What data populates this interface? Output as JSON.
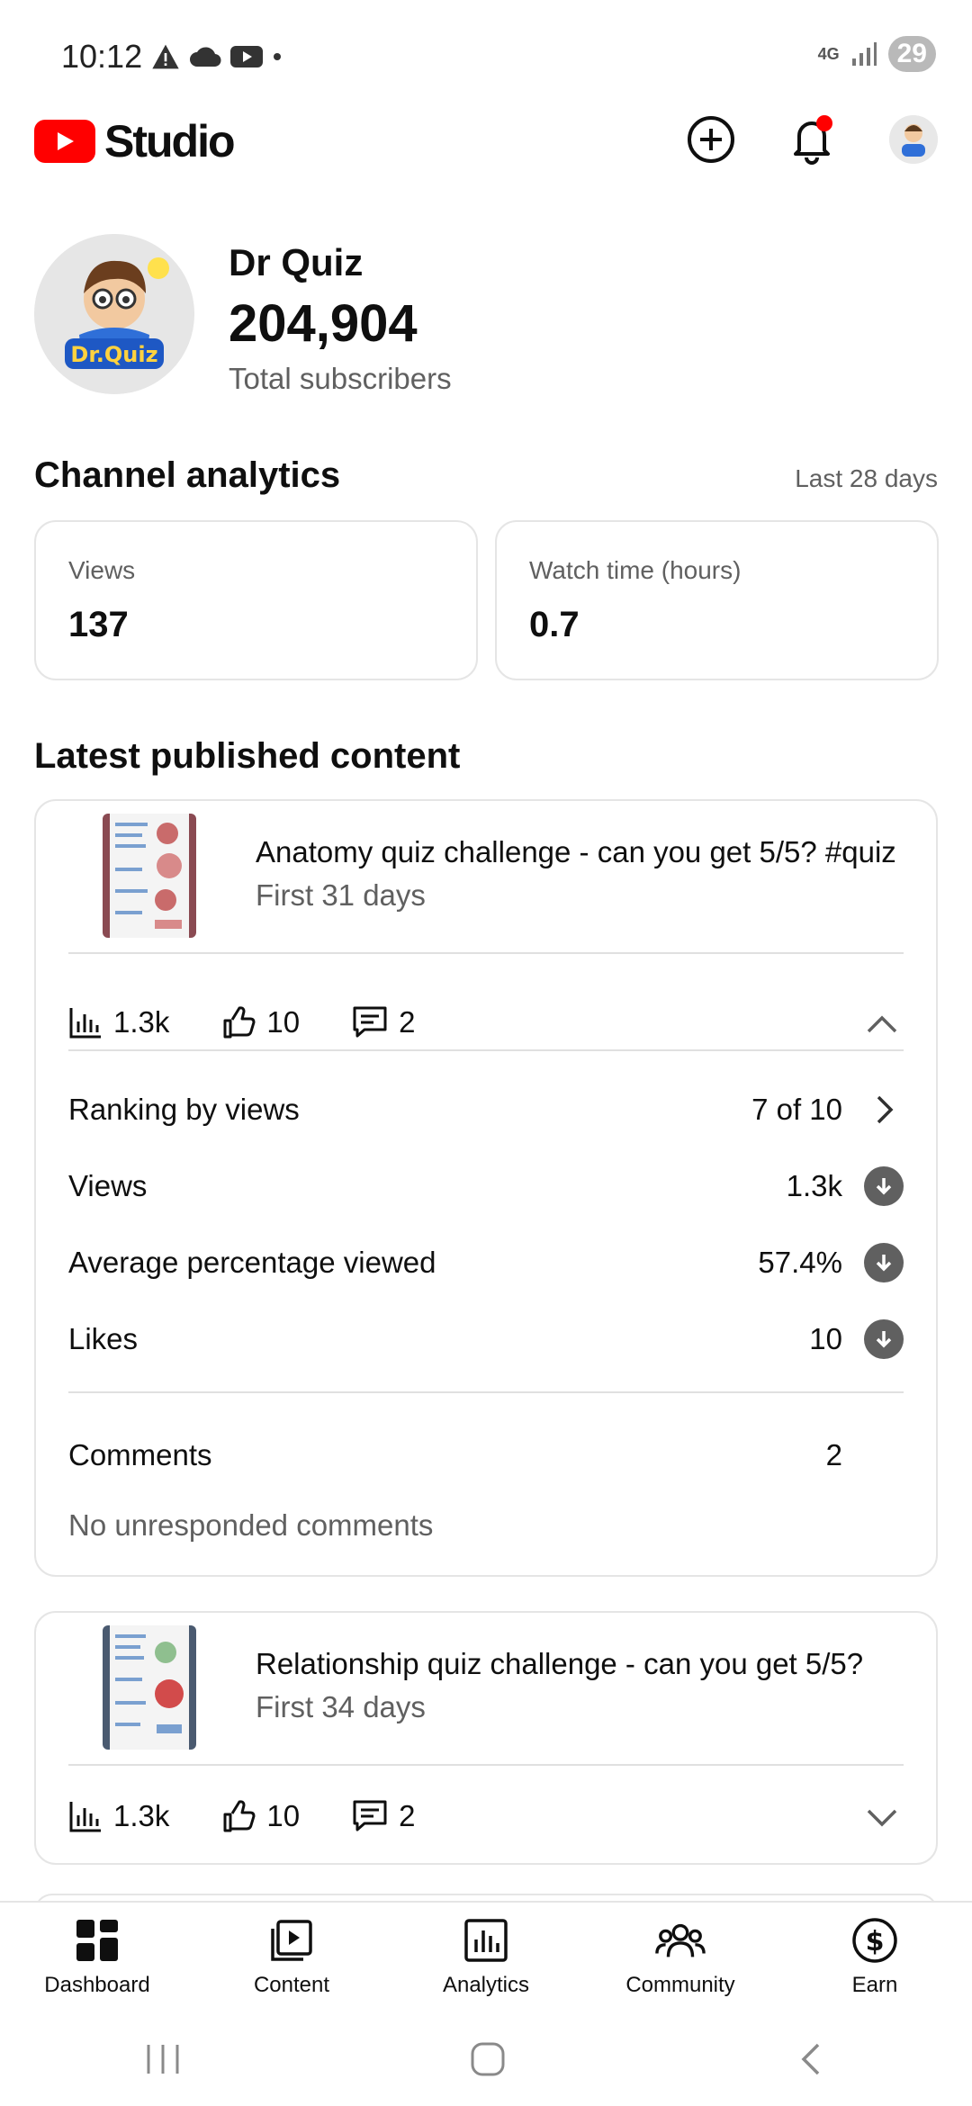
{
  "status_bar": {
    "time": "10:12",
    "network": "4G",
    "battery": "29"
  },
  "header": {
    "logo_text": "Studio"
  },
  "channel": {
    "name": "Dr Quiz",
    "subscribers": "204,904",
    "subscribers_label": "Total subscribers"
  },
  "analytics": {
    "title": "Channel analytics",
    "period": "Last 28 days",
    "cards": [
      {
        "label": "Views",
        "value": "137"
      },
      {
        "label": "Watch time (hours)",
        "value": "0.7"
      }
    ]
  },
  "latest": {
    "title": "Latest published content",
    "videos": [
      {
        "title": "Anatomy quiz challenge - can you get 5/5? #quiz",
        "period": "First 31 days",
        "views": "1.3k",
        "likes": "10",
        "comments": "2",
        "details": {
          "ranking_label": "Ranking by views",
          "ranking_value": "7 of 10",
          "views_label": "Views",
          "views_value": "1.3k",
          "avg_label": "Average percentage viewed",
          "avg_value": "57.4%",
          "likes_label": "Likes",
          "likes_value": "10",
          "comments_label": "Comments",
          "comments_value": "2",
          "unresponded": "No unresponded comments"
        }
      },
      {
        "title": "Relationship quiz challenge - can you get 5/5?",
        "period": "First 34 days",
        "views": "1.3k",
        "likes": "10",
        "comments": "2"
      }
    ]
  },
  "bottom_nav": [
    {
      "label": "Dashboard",
      "icon": "dashboard-icon"
    },
    {
      "label": "Content",
      "icon": "content-icon"
    },
    {
      "label": "Analytics",
      "icon": "analytics-icon"
    },
    {
      "label": "Community",
      "icon": "community-icon"
    },
    {
      "label": "Earn",
      "icon": "earn-icon"
    }
  ],
  "colors": {
    "brand_red": "#ff0000",
    "text_primary": "#0f0f0f",
    "text_secondary": "#606060"
  }
}
